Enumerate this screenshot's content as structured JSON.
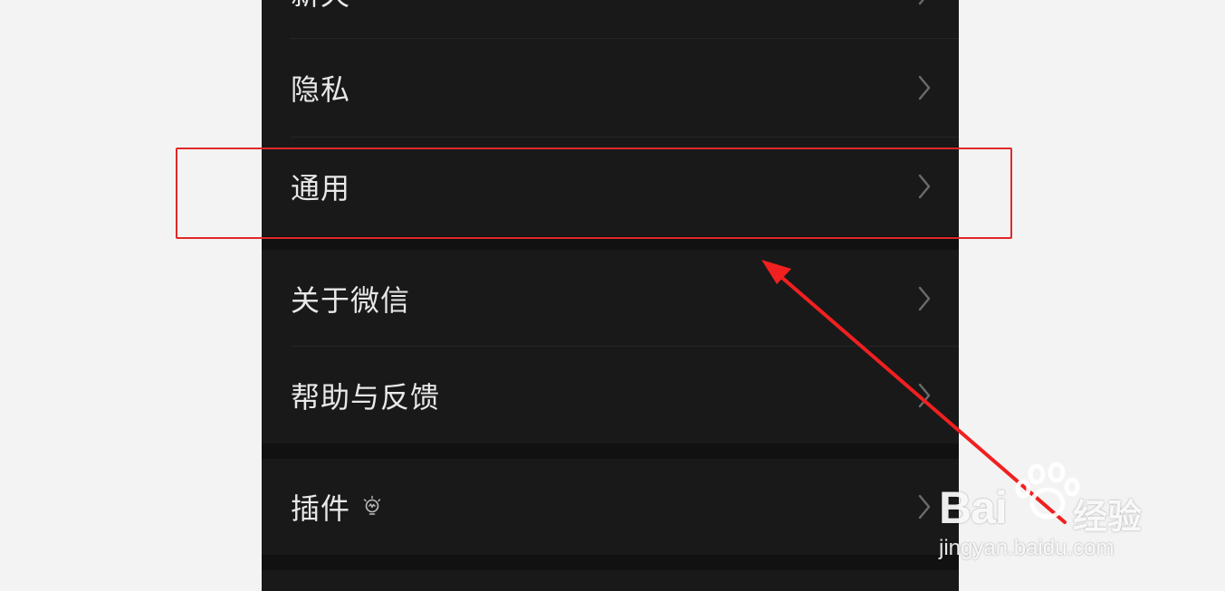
{
  "settings": {
    "items": [
      {
        "label": "新天",
        "icon": "chevron-right-icon"
      },
      {
        "label": "隐私",
        "icon": "chevron-right-icon"
      },
      {
        "label": "通用",
        "icon": "chevron-right-icon"
      },
      {
        "label": "关于微信",
        "icon": "chevron-right-icon"
      },
      {
        "label": "帮助与反馈",
        "icon": "chevron-right-icon"
      },
      {
        "label": "插件",
        "icon": "chevron-right-icon",
        "badge_icon": "lightbulb-icon"
      }
    ]
  },
  "annotation": {
    "highlight_color": "#e02828",
    "arrow_color": "#f02020"
  },
  "watermark": {
    "brand": "Bai",
    "brand_tail": "经验",
    "url": "jingyan.baidu.com"
  },
  "colors": {
    "background": "#191919",
    "text": "#e8e8e8",
    "chevron": "#6b6b6b"
  }
}
